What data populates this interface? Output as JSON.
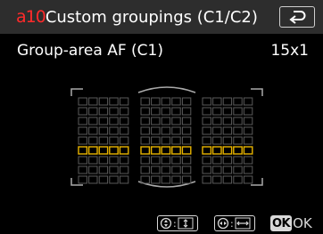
{
  "header": {
    "menu_code": "a10",
    "title": "Custom groupings (C1/C2)",
    "back_icon": "return-arrow-icon"
  },
  "setting": {
    "label": "Group-area AF (C1)",
    "value": "15x1"
  },
  "af_grid": {
    "columns_per_block": 5,
    "blocks": 3,
    "rows": 9,
    "selected_row": 5,
    "normal_color": "#5a5a5a",
    "selected_color": "#e8b400"
  },
  "footer": {
    "hint_1_icon": "multi-selector-up-down-icon",
    "hint_2_icon": "multi-selector-left-right-icon",
    "ok_key": "OK",
    "ok_label": "OK"
  },
  "colors": {
    "header_bg": "#2d2d2d",
    "menu_code": "#ff2a2a",
    "background": "#000000"
  }
}
